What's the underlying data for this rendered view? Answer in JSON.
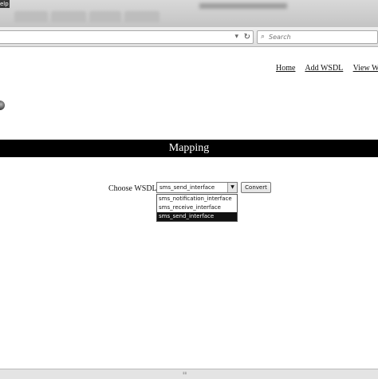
{
  "browser": {
    "menu_help_fragment": "elp",
    "url": "",
    "url_dropdown_icon": "chevron-down-icon",
    "reload_icon": "reload-icon",
    "search": {
      "placeholder": "Search",
      "icon": "search-icon"
    }
  },
  "nav": {
    "items": [
      {
        "label": "Home"
      },
      {
        "label": "Add WSDL"
      },
      {
        "label": "View WS"
      }
    ]
  },
  "banner": {
    "title": "Mapping"
  },
  "form": {
    "label": "Choose WSDL",
    "selected": "sms_send_interface",
    "options": [
      "sms_notification_interface",
      "sms_receive_interface",
      "sms_send_interface"
    ],
    "selected_option_index": 2,
    "button": "Convert"
  },
  "statusbar": {
    "icon": "status-icon"
  }
}
